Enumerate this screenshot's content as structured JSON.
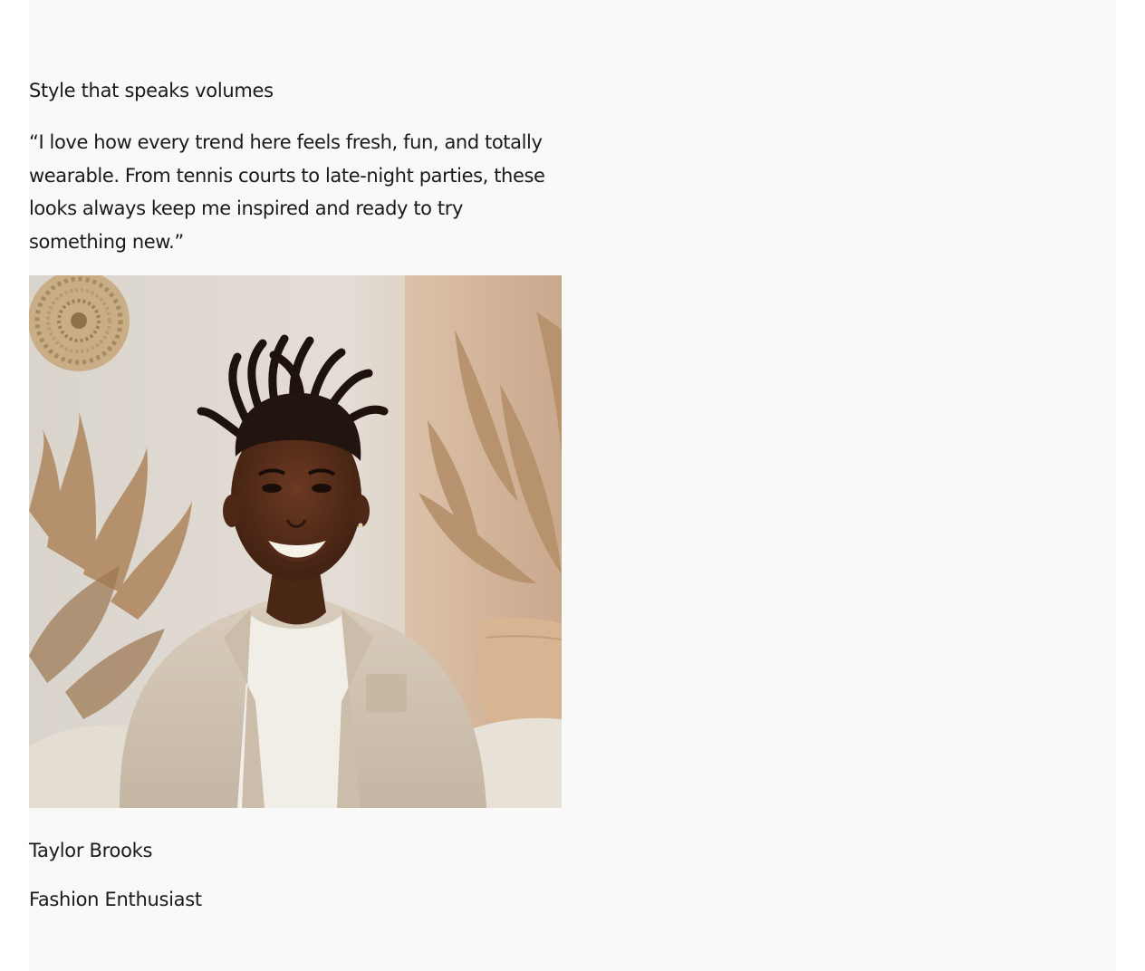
{
  "testimonial": {
    "heading": "Style that speaks volumes",
    "quote": "“I love how every trend here feels fresh, fun, and totally wearable. From tennis courts to late-night parties, these looks always keep me inspired and ready to try something new.”",
    "author_name": "Taylor Brooks",
    "author_role": "Fashion Enthusiast"
  },
  "colors": {
    "section_background": "#f9f9f7",
    "text": "#1a1a1a"
  }
}
